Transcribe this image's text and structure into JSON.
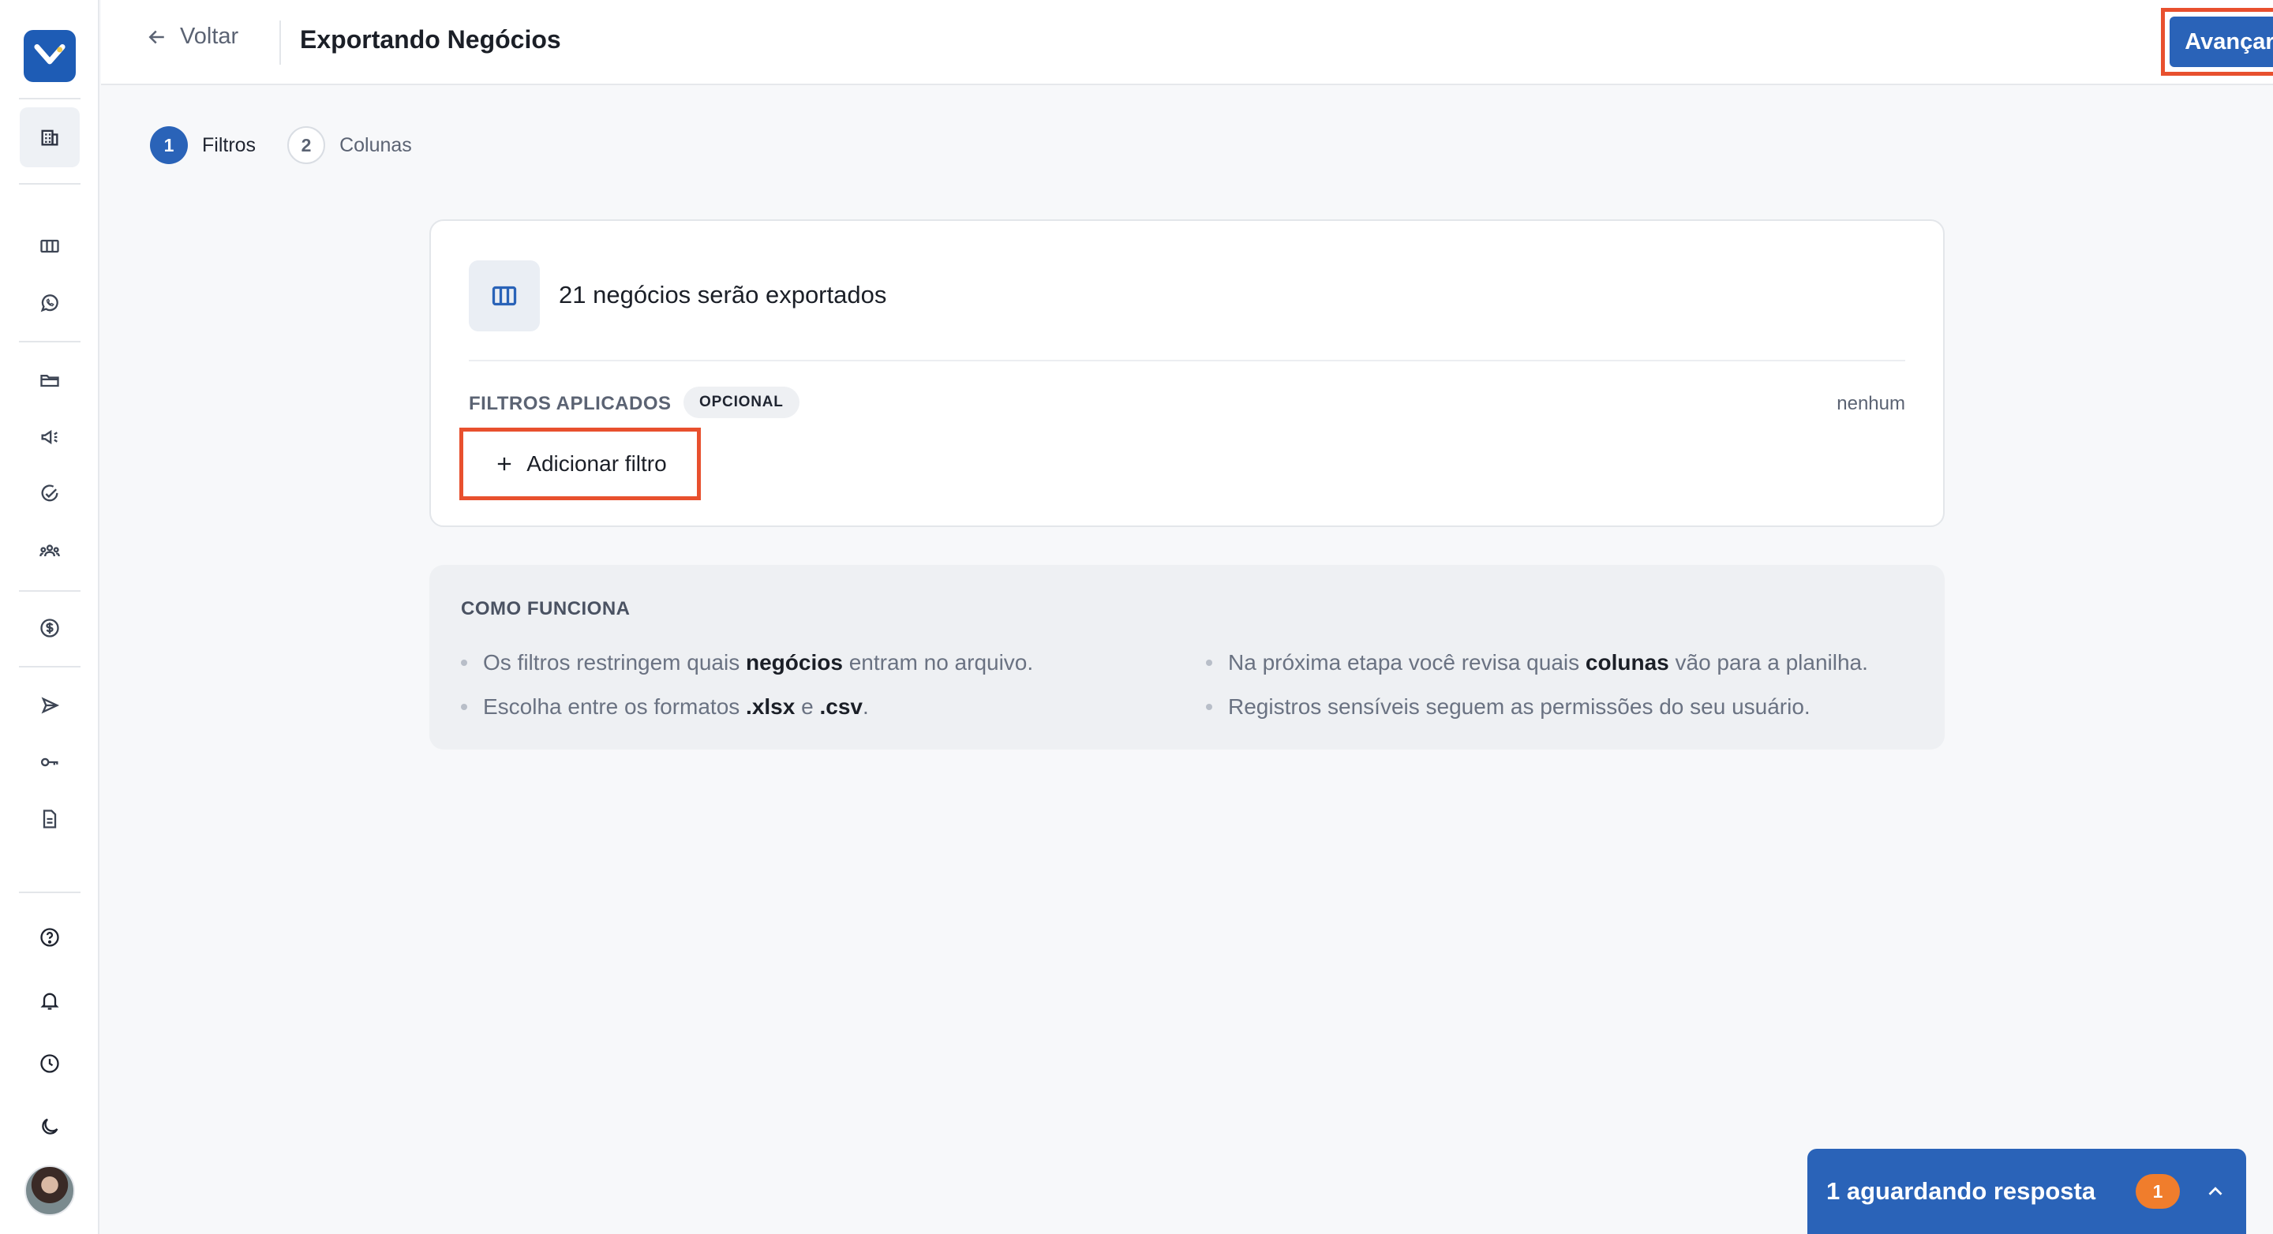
{
  "header": {
    "back_label": "Voltar",
    "title": "Exportando Negócios",
    "advance_label": "Avançar"
  },
  "stepper": {
    "steps": [
      {
        "number": "1",
        "label": "Filtros",
        "active": true
      },
      {
        "number": "2",
        "label": "Colunas",
        "active": false
      }
    ]
  },
  "export_card": {
    "summary": "21 negócios serão exportados",
    "filters_label": "FILTROS APLICADOS",
    "optional_badge": "OPCIONAL",
    "filters_value": "nenhum",
    "add_filter_label": "Adicionar filtro"
  },
  "how_it_works": {
    "title": "COMO FUNCIONA",
    "left": [
      {
        "pre": "Os filtros restringem quais ",
        "bold": "negócios",
        "post": " entram no arquivo."
      },
      {
        "pre": "Escolha entre os formatos ",
        "bold": ".xlsx",
        "mid": " e ",
        "bold2": ".csv",
        "post": "."
      }
    ],
    "right": [
      {
        "pre": "Na próxima etapa você revisa quais ",
        "bold": "colunas",
        "post": " vão para a planilha."
      },
      {
        "pre": "Registros sensíveis seguem as permissões do seu usuário.",
        "bold": "",
        "post": ""
      }
    ]
  },
  "waiting_widget": {
    "label": "1 aguardando resposta",
    "count": "1"
  },
  "colors": {
    "accent": "#2a63b8",
    "highlight_border": "#e8502e",
    "badge_orange": "#f07d2c"
  },
  "sidebar_icons": [
    "logo-icon",
    "building-icon",
    "kanban-icon",
    "whatsapp-icon",
    "folder-icon",
    "megaphone-icon",
    "check-circle-icon",
    "team-icon",
    "dollar-icon",
    "send-icon",
    "key-icon",
    "document-icon",
    "help-icon",
    "bell-icon",
    "clock-icon",
    "moon-icon"
  ]
}
